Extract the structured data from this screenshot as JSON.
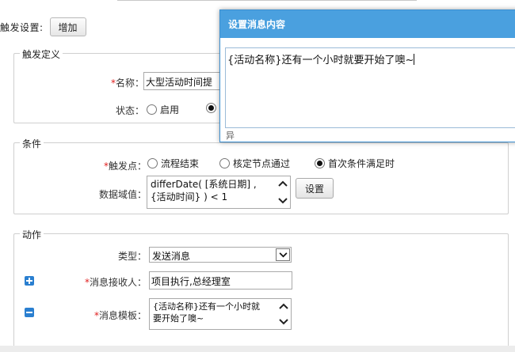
{
  "trigger_settings": {
    "label": "触发设置:",
    "add_button": "增加"
  },
  "definition": {
    "legend": "触发定义",
    "name_label": "名称：",
    "name_value": "大型活动时间提",
    "status_label": "状态：",
    "status_option_enabled": "启用"
  },
  "condition": {
    "legend": "条件",
    "trigger_point_label": "触发点：",
    "options": [
      "流程结束",
      "核定节点通过",
      "首次条件满足时"
    ],
    "selected_index": 2,
    "domain_label": "数据域值：",
    "domain_value_line1": "differDate( [系统日期] ,",
    "domain_value_line2": "{活动时间} )  <  1",
    "set_button": "设置"
  },
  "action": {
    "legend": "动作",
    "type_label": "类型：",
    "type_value": "发送消息",
    "recipient_label": "消息接收人：",
    "recipient_value": "项目执行,总经理室",
    "template_label": "消息模板：",
    "template_line1": "{活动名称}还有一个小时就",
    "template_line2": "要开始了噢~"
  },
  "dialog": {
    "title": "设置消息内容",
    "content": "{活动名称}还有一个小时就要开始了噢~",
    "under_text": "异"
  },
  "colors": {
    "dialog_title_bg": "#4aa0df",
    "required_star": "#e02020",
    "toggle_icon": "#2a7fd0"
  }
}
